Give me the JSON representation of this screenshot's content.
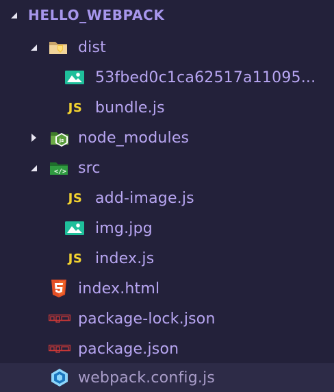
{
  "explorer": {
    "root": {
      "label": "HELLO_WEBPACK",
      "expanded": true
    },
    "items": [
      {
        "label": "dist",
        "type": "folder",
        "icon": "folder-dist-icon",
        "expanded": true
      },
      {
        "label": "53fbed0c1ca62517a11095...",
        "type": "file",
        "icon": "image-file-icon"
      },
      {
        "label": "bundle.js",
        "type": "file",
        "icon": "js-file-icon"
      },
      {
        "label": "node_modules",
        "type": "folder",
        "icon": "folder-node-icon",
        "expanded": false
      },
      {
        "label": "src",
        "type": "folder",
        "icon": "folder-src-icon",
        "expanded": true
      },
      {
        "label": "add-image.js",
        "type": "file",
        "icon": "js-file-icon"
      },
      {
        "label": "img.jpg",
        "type": "file",
        "icon": "image-file-icon"
      },
      {
        "label": "index.js",
        "type": "file",
        "icon": "js-file-icon"
      },
      {
        "label": "index.html",
        "type": "file",
        "icon": "html5-icon"
      },
      {
        "label": "package-lock.json",
        "type": "file",
        "icon": "npm-icon"
      },
      {
        "label": "package.json",
        "type": "file",
        "icon": "npm-icon"
      },
      {
        "label": "webpack.config.js",
        "type": "file",
        "icon": "webpack-icon",
        "selected": true
      }
    ],
    "js_icon_text": "JS",
    "colors": {
      "background": "#23213a",
      "selected_row": "#2d2b47",
      "label": "#b8a6f2",
      "js_yellow": "#f3d330",
      "image_teal": "#1fbf9b",
      "html_orange": "#e34f26",
      "npm_red": "#cb3837",
      "webpack_blue": "#8ed6fb",
      "node_green": "#5a9e3c",
      "src_green": "#2a8f3a",
      "dist_folder": "#e6c07b"
    }
  }
}
